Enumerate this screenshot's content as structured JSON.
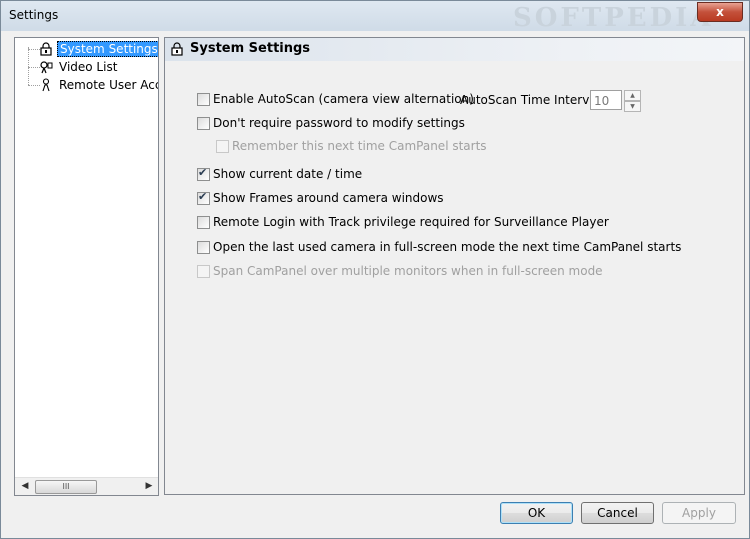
{
  "window": {
    "title": "Settings",
    "close_glyph": "x"
  },
  "tree": {
    "items": [
      {
        "label": "System Settings",
        "icon": "lock-icon",
        "selected": true
      },
      {
        "label": "Video List",
        "icon": "camera-icon",
        "selected": false
      },
      {
        "label": "Remote User Acco",
        "icon": "user-icon",
        "selected": false
      }
    ],
    "scroll_thumb_glyph": "III",
    "scroll_left_glyph": "◀",
    "scroll_right_glyph": "▶"
  },
  "panel": {
    "title": "System Settings",
    "options": [
      {
        "label": "Enable AutoScan (camera view alternation)",
        "checked": false,
        "enabled": true
      },
      {
        "label": "Don't require password to modify settings",
        "checked": false,
        "enabled": true
      },
      {
        "label": "Remember this next time CamPanel starts",
        "checked": false,
        "enabled": false
      },
      {
        "label": "Show current date / time",
        "checked": true,
        "enabled": true
      },
      {
        "label": "Show Frames around camera windows",
        "checked": true,
        "enabled": true
      },
      {
        "label": "Remote Login with Track privilege required for Surveillance Player",
        "checked": false,
        "enabled": true
      },
      {
        "label": "Open the last used camera in full-screen mode the next time CamPanel starts",
        "checked": false,
        "enabled": true
      },
      {
        "label": "Span CamPanel over multiple monitors when in full-screen mode",
        "checked": false,
        "enabled": false
      }
    ],
    "autoscan_interval": {
      "label": "AutoScan Time Interval (s)",
      "value": "10"
    }
  },
  "buttons": {
    "ok": "OK",
    "cancel": "Cancel",
    "apply": "Apply"
  },
  "colors": {
    "selection": "#3399ff",
    "disabled_text": "#a0a0a0",
    "close": "#c4513b"
  }
}
